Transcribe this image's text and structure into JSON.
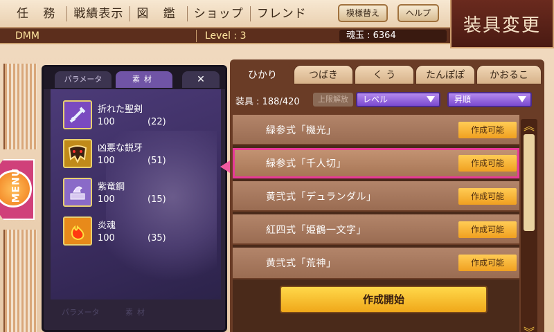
{
  "nav": {
    "items": [
      "任 務",
      "戦績表示",
      "図 鑑",
      "ショップ",
      "フレンド"
    ],
    "pattern_button": "模様替え",
    "help_button": "ヘルプ"
  },
  "info": {
    "user": "DMM",
    "level": "Level : 3",
    "gems": "魂玉 : 6364"
  },
  "screen_title": "装具変更",
  "menu_tab": "MENU",
  "left_panel": {
    "tabs": {
      "param": "パラメータ",
      "material": "素材",
      "close": "✕"
    },
    "materials": [
      {
        "name": "折れた聖剣",
        "value": "100",
        "count": "(22)",
        "icon": "broken-sword-icon",
        "color": "#7a4ac0"
      },
      {
        "name": "凶悪な鋭牙",
        "value": "100",
        "count": "(51)",
        "icon": "fang-mask-icon",
        "color": "#c08a1a"
      },
      {
        "name": "紫竜鋼",
        "value": "100",
        "count": "(15)",
        "icon": "dragon-steel-icon",
        "color": "#8a6ac8"
      },
      {
        "name": "炎魂",
        "value": "100",
        "count": "(35)",
        "icon": "flame-icon",
        "color": "#e88a1a"
      }
    ],
    "faded_tabs": [
      "パラメータ",
      "素材"
    ]
  },
  "right_panel": {
    "char_tabs": [
      "ひかり",
      "つばき",
      "く う",
      "たんぽぽ",
      "かおるこ"
    ],
    "equip_count": "装具 : 188/420",
    "limit_button": "上限解放",
    "sort_field": "レベル",
    "sort_order": "昇順",
    "items": [
      {
        "name": "緑参式「機光」",
        "status": "作成可能"
      },
      {
        "name": "緑参式「千人切」",
        "status": "作成可能",
        "selected": true
      },
      {
        "name": "黄弐式「デュランダル」",
        "status": "作成可能"
      },
      {
        "name": "紅四式「姫鶴一文字」",
        "status": "作成可能"
      },
      {
        "name": "黄弐式「荒神」",
        "status": "作成可能"
      }
    ],
    "start_button": "作成開始"
  }
}
